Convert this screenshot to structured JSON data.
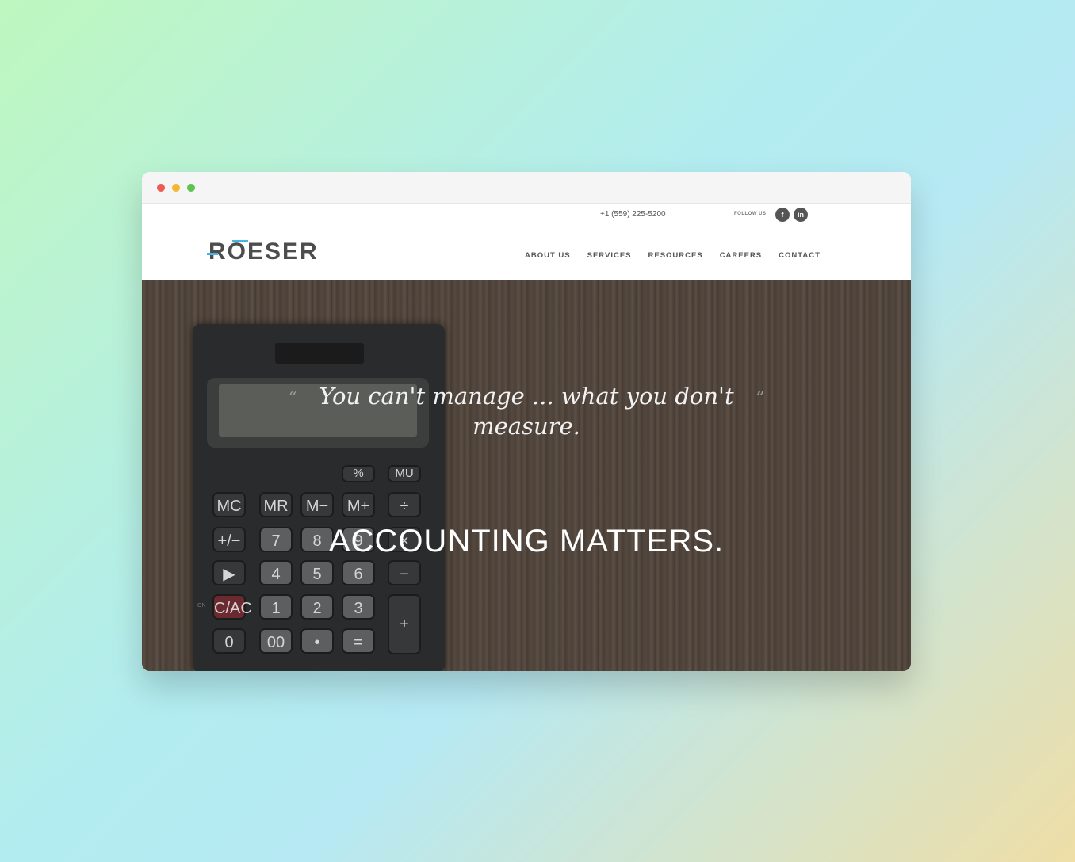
{
  "window": {
    "dots": [
      "#ee5b50",
      "#f5b731",
      "#5ec44e"
    ]
  },
  "topbar": {
    "phone": "+1 (559) 225-5200",
    "follow_label": "FOLLOW US:",
    "social": [
      {
        "icon": "facebook-icon",
        "label": "f"
      },
      {
        "icon": "linkedin-icon",
        "label": "in"
      }
    ]
  },
  "logo": {
    "text": "ROESER",
    "accent": "#47b4e3"
  },
  "nav": {
    "items": [
      "ABOUT US",
      "SERVICES",
      "RESOURCES",
      "CAREERS",
      "CONTACT"
    ]
  },
  "hero": {
    "quote_open": "“",
    "quote": "You can't manage ... what you don't measure.",
    "quote_close": "”",
    "headline": "ACCOUNTING MATTERS."
  },
  "calculator": {
    "keys": [
      "%",
      "MU",
      "MC",
      "MR",
      "M−",
      "M+",
      "÷",
      "+/−",
      "7",
      "8",
      "9",
      "×",
      "▶",
      "4",
      "5",
      "6",
      "−",
      "C/AC",
      "1",
      "2",
      "3",
      "+",
      "0",
      "00",
      "•",
      "="
    ],
    "on_label": "ON"
  }
}
